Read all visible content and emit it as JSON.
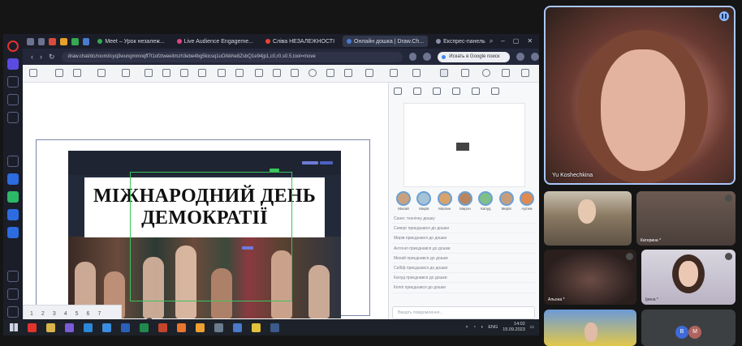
{
  "browser": {
    "tabs": [
      {
        "label": "Meet – Урок незалеж...",
        "color": "#34a853"
      },
      {
        "label": "Live Audience Engageme...",
        "color": "#e04488"
      },
      {
        "label": "Сліва НЕЗАЛЕЖНОСТІ",
        "color": "#ea4335"
      },
      {
        "label": "Онлайн дошка | Draw.Ch...",
        "color": "#4a7bd0"
      },
      {
        "label": "Експрес-панель",
        "color": "#8a8fa3"
      }
    ],
    "url": "draw.chat/dc/room/icyq3wungmmnqff7t1ofztweeitmzh3ebe4bg5kicsq1uO/kkhe8ZsbQ1e94jp1,c0,r0,s0.5,tool=move",
    "search_placeholder": "Искать в Google поиск"
  },
  "slide": {
    "title_line1": "МІЖНАРОДНИЙ ДЕНЬ",
    "title_line2": "ДЕМОКРАТІЇ"
  },
  "whiteboard": {
    "pages": [
      "1",
      "2",
      "3",
      "4",
      "5",
      "6",
      "7"
    ],
    "participants": [
      "Михай",
      "Мирів",
      "Маілин",
      "Мирон",
      "Калуд",
      "Мирів",
      "Артем"
    ],
    "chat_log": [
      "Саню: технічну дошку",
      "Северг приєднався до дошки",
      "Мирів приєднався до дошки",
      "Антоніл приєднався до дошки",
      "Михай приєднався до дошки",
      "Сабіф приєднався до дошки",
      "Калуд приєднався до дошки",
      "Кеппі приєднався до дошки"
    ],
    "chat_placeholder": "Введіть повідомлення..."
  },
  "taskbar": {
    "lang": "ENG",
    "time": "14:02",
    "date": "15.09.2023"
  },
  "meet": {
    "main_speaker": "Yu Koshechkina",
    "tiles": [
      {
        "name": ""
      },
      {
        "name": "Катерина *"
      },
      {
        "name": "Альона *"
      },
      {
        "name": "Ірина *"
      },
      {
        "name": ""
      }
    ],
    "initials": [
      "В",
      "М"
    ],
    "initial_colors": [
      "#3f6ad8",
      "#b0635f"
    ]
  },
  "colors": {
    "meet_active_border": "#a8c7fa",
    "opera_red": "#e0342d",
    "slide_bg": "#222a3a"
  }
}
